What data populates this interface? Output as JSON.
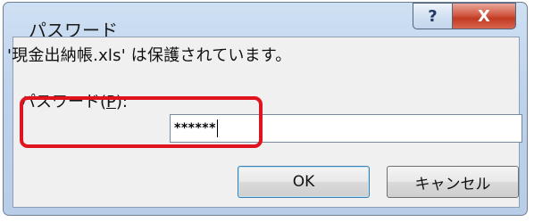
{
  "dialog": {
    "title": "パスワード",
    "help_glyph": "?",
    "close_glyph": "X",
    "message": "'現金出納帳.xls' は保護されています。",
    "password_label_prefix": "パスワード(",
    "password_label_key": "P",
    "password_label_suffix": "):",
    "password_value": "******",
    "ok_label": "OK",
    "cancel_label": "キャンセル"
  },
  "colors": {
    "highlight": "#e0141e",
    "close_button": "#c23a22"
  }
}
